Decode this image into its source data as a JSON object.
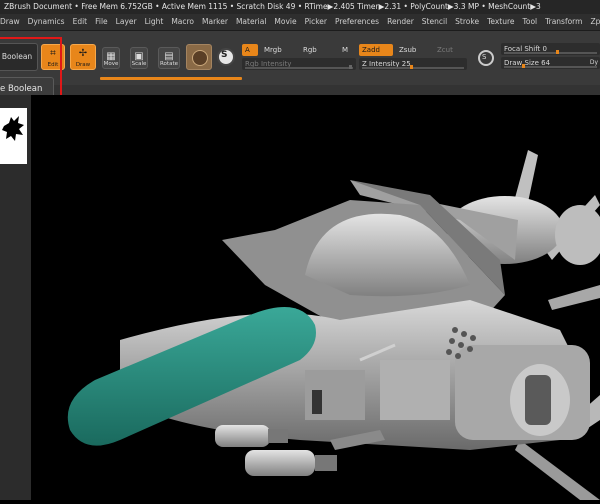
{
  "title_bar": {
    "text": "ZBrush Document   • Free Mem 6.752GB • Active Mem 1115 • Scratch Disk 49 •  RTime▶2.405 Timer▶2.31 • PolyCount▶3.3 MP  • MeshCount▶3"
  },
  "menu": [
    "Draw",
    "Dynamics",
    "Edit",
    "File",
    "Layer",
    "Light",
    "Macro",
    "Marker",
    "Material",
    "Movie",
    "Picker",
    "Preferences",
    "Render",
    "Stencil",
    "Stroke",
    "Texture",
    "Tool",
    "Transform",
    "Zplugin"
  ],
  "shelf": {
    "boolean_label": "Boolean",
    "edit_label": "Edit",
    "draw_label": "Draw",
    "move_label": "Move",
    "scale_label": "Scale",
    "rotate_label": "Rotate",
    "a_label": "A",
    "mrgb_label": "Mrgb",
    "rgb_label": "Rgb",
    "m_label": "M",
    "rgb_intensity_label": "Rgb Intensity",
    "zadd_label": "Zadd",
    "zsub_label": "Zsub",
    "zcut_label": "Zcut",
    "z_intensity_label": "Z Intensity",
    "z_intensity_value": "25",
    "focal_shift_label": "Focal Shift",
    "focal_shift_value": "0",
    "draw_size_label": "Draw Size",
    "draw_size_value": "64",
    "dyn_label": "Dy"
  },
  "dropdown": {
    "label": "ve Boolean"
  },
  "colors": {
    "accent": "#e8861a",
    "highlight": "#e01818",
    "hull_teal": "#2a8f80"
  },
  "icons": [
    "edit-icon",
    "draw-icon",
    "move-icon",
    "scale-icon",
    "rotate-icon",
    "brush-icon",
    "s-icon"
  ]
}
